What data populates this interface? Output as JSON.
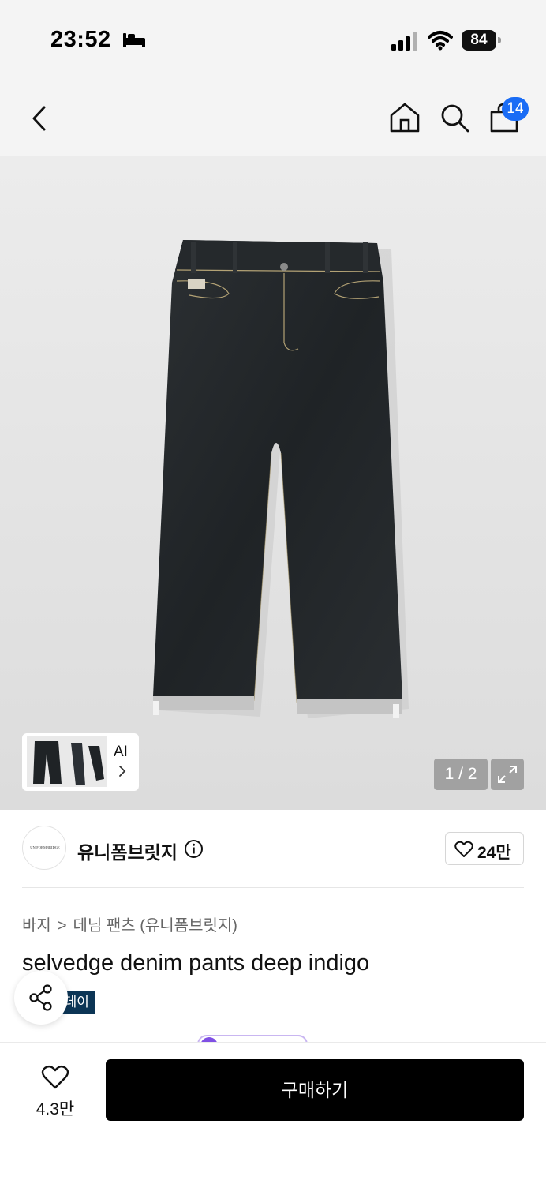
{
  "status_bar": {
    "time": "23:52",
    "battery": "84"
  },
  "nav": {
    "cart_count": "14"
  },
  "gallery": {
    "ai_label": "AI",
    "page_indicator": "1 / 2"
  },
  "brand": {
    "logo_text": "UNIFORMBRIDGE",
    "name": "유니폼브릿지",
    "like_count": "24만"
  },
  "product": {
    "breadcrumb": [
      "바지",
      "데님 팬츠 (유니폼브릿지)"
    ],
    "title": "selvedge denim pants deep indigo",
    "tag": "스데이"
  },
  "bottom_bar": {
    "wish_count": "4.3만",
    "buy_label": "구매하기"
  },
  "colors": {
    "accent_blue": "#1a6cf5",
    "tag_navy": "#0c3555",
    "purple": "#7f4fe4"
  }
}
